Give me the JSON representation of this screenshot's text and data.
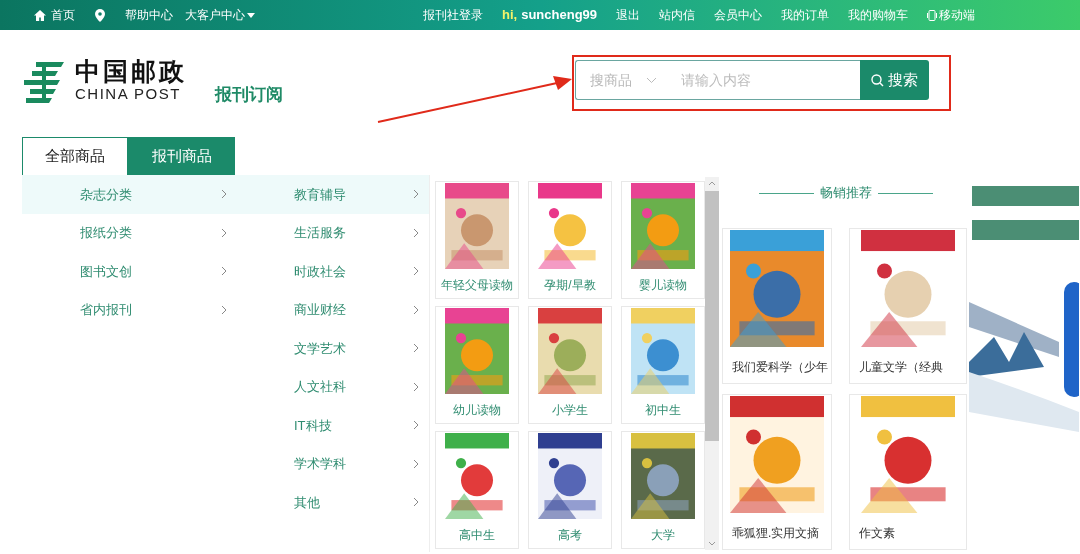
{
  "top_nav": {
    "left": [
      {
        "kind": "home",
        "label": "首页"
      },
      {
        "kind": "location"
      },
      {
        "kind": "link",
        "label": "帮助中心"
      },
      {
        "kind": "dropdown",
        "label": "大客户中心"
      }
    ],
    "right": [
      {
        "kind": "link",
        "label": "报刊社登录"
      },
      {
        "kind": "greeting",
        "greeting": "hi,",
        "username": "suncheng99"
      },
      {
        "kind": "link",
        "label": "退出"
      },
      {
        "kind": "link",
        "label": "站内信"
      },
      {
        "kind": "link",
        "label": "会员中心"
      },
      {
        "kind": "link",
        "label": "我的订单"
      },
      {
        "kind": "link",
        "label": "我的购物车"
      },
      {
        "kind": "mobile",
        "label": "移动端"
      }
    ]
  },
  "logo": {
    "name_cn": "中国邮政",
    "name_en": "CHINA POST",
    "section": "报刊订阅"
  },
  "search": {
    "scope": "搜商品",
    "placeholder": "请输入内容",
    "button": "搜索"
  },
  "tabs": [
    {
      "label": "全部商品",
      "selected": false
    },
    {
      "label": "报刊商品",
      "selected": true
    }
  ],
  "categories": [
    {
      "label": "杂志分类",
      "selected": true
    },
    {
      "label": "报纸分类",
      "selected": false
    },
    {
      "label": "图书文创",
      "selected": false
    },
    {
      "label": "省内报刊",
      "selected": false
    }
  ],
  "subcategories": [
    {
      "label": "教育辅导",
      "selected": true
    },
    {
      "label": "生活服务",
      "selected": false
    },
    {
      "label": "时政社会",
      "selected": false
    },
    {
      "label": "商业财经",
      "selected": false
    },
    {
      "label": "文学艺术",
      "selected": false
    },
    {
      "label": "人文社科",
      "selected": false
    },
    {
      "label": "IT科技",
      "selected": false
    },
    {
      "label": "学术学科",
      "selected": false
    },
    {
      "label": "其他",
      "selected": false
    }
  ],
  "magazines": [
    {
      "label": "年轻父母读物"
    },
    {
      "label": "孕期/早教"
    },
    {
      "label": "婴儿读物"
    },
    {
      "label": "幼儿读物"
    },
    {
      "label": "小学生"
    },
    {
      "label": "初中生"
    },
    {
      "label": "高中生"
    },
    {
      "label": "高考"
    },
    {
      "label": "大学"
    }
  ],
  "bestsellers": {
    "title": "畅销推荐",
    "items": [
      {
        "label": "我们爱科学（少年"
      },
      {
        "label": "儿童文学（经典"
      },
      {
        "label": "乖狐狸.实用文摘"
      },
      {
        "label": "作文素"
      }
    ]
  }
}
